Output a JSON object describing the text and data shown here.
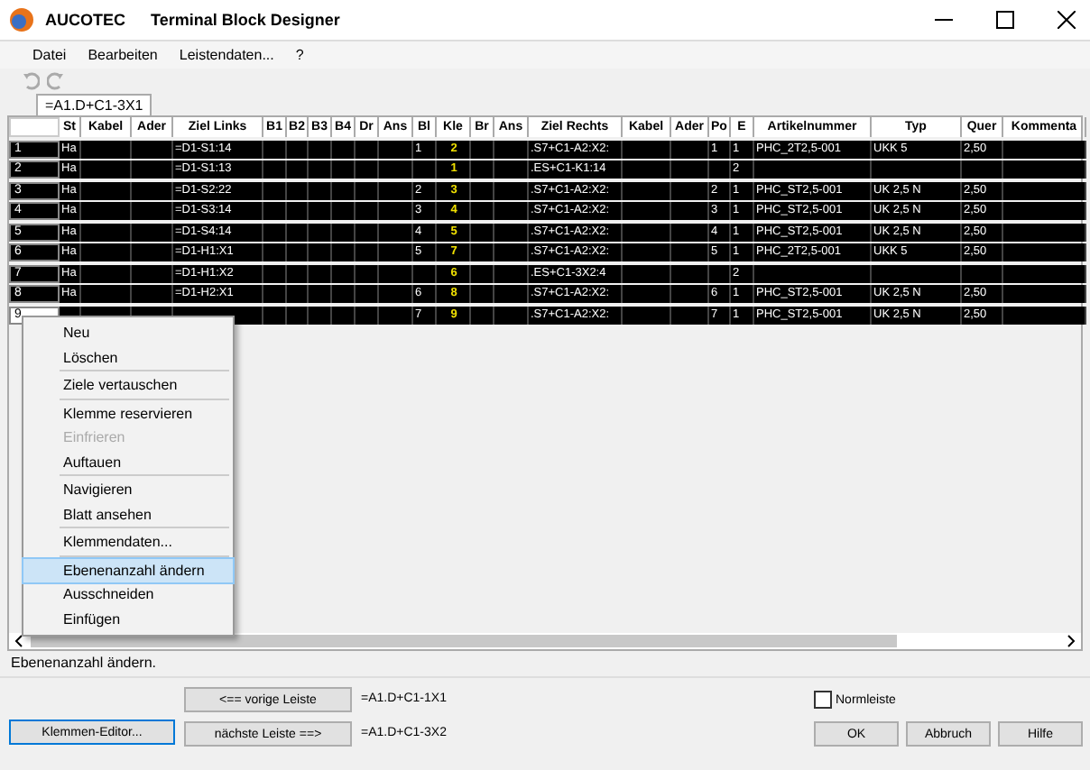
{
  "window": {
    "brand": "AUCOTEC",
    "title": "Terminal Block Designer"
  },
  "menu_bar": [
    "Datei",
    "Bearbeiten",
    "Leistendaten...",
    "?"
  ],
  "tab": {
    "label": "=A1.D+C1-3X1"
  },
  "table": {
    "columns": [
      {
        "label": "St",
        "kind": "text"
      },
      {
        "label": "Kabel",
        "kind": "text"
      },
      {
        "label": "Ader",
        "kind": "text"
      },
      {
        "label": "Ziel Links",
        "kind": "text"
      },
      {
        "label": "B1",
        "kind": "text"
      },
      {
        "label": "B2",
        "kind": "text"
      },
      {
        "label": "B3",
        "kind": "text"
      },
      {
        "label": "B4",
        "kind": "text"
      },
      {
        "label": "Dr",
        "kind": "text"
      },
      {
        "label": "Ans",
        "kind": "text"
      },
      {
        "label": "Bl",
        "kind": "text"
      },
      {
        "label": "Kle",
        "kind": "terminal"
      },
      {
        "label": "Br",
        "kind": "text"
      },
      {
        "label": "Ans",
        "kind": "text"
      },
      {
        "label": "Ziel Rechts",
        "kind": "text"
      },
      {
        "label": "Kabel",
        "kind": "text"
      },
      {
        "label": "Ader",
        "kind": "text"
      },
      {
        "label": "Po",
        "kind": "text"
      },
      {
        "label": "E",
        "kind": "text"
      },
      {
        "label": "Artikelnummer",
        "kind": "text"
      },
      {
        "label": "Typ",
        "kind": "text"
      },
      {
        "label": "Quer",
        "kind": "text"
      },
      {
        "label": "Kommenta",
        "kind": "text"
      }
    ],
    "rows": [
      {
        "number": "1",
        "selected": false,
        "cells": [
          "Ha",
          null,
          null,
          "=D1-S1:14",
          null,
          null,
          null,
          null,
          null,
          null,
          "1",
          "2",
          null,
          null,
          ".S7+C1-A2:X2:",
          null,
          null,
          "1",
          "1",
          "PHC_2T2,5-001",
          "UKK 5",
          "2,50",
          null
        ]
      },
      {
        "number": "2",
        "selected": false,
        "cells": [
          "Ha",
          null,
          null,
          "=D1-S1:13",
          null,
          null,
          null,
          null,
          null,
          null,
          null,
          "1",
          null,
          null,
          ".ES+C1-K1:14",
          null,
          null,
          null,
          "2",
          null,
          null,
          null,
          null
        ]
      },
      {
        "number": "3",
        "selected": false,
        "cells": [
          "Ha",
          null,
          null,
          "=D1-S2:22",
          null,
          null,
          null,
          null,
          null,
          null,
          "2",
          "3",
          null,
          null,
          ".S7+C1-A2:X2:",
          null,
          null,
          "2",
          "1",
          "PHC_ST2,5-001",
          "UK 2,5 N",
          "2,50",
          null
        ]
      },
      {
        "number": "4",
        "selected": false,
        "cells": [
          "Ha",
          null,
          null,
          "=D1-S3:14",
          null,
          null,
          null,
          null,
          null,
          null,
          "3",
          "4",
          null,
          null,
          ".S7+C1-A2:X2:",
          null,
          null,
          "3",
          "1",
          "PHC_ST2,5-001",
          "UK 2,5 N",
          "2,50",
          null
        ]
      },
      {
        "number": "5",
        "selected": false,
        "cells": [
          "Ha",
          null,
          null,
          "=D1-S4:14",
          null,
          null,
          null,
          null,
          null,
          null,
          "4",
          "5",
          null,
          null,
          ".S7+C1-A2:X2:",
          null,
          null,
          "4",
          "1",
          "PHC_ST2,5-001",
          "UK 2,5 N",
          "2,50",
          null
        ]
      },
      {
        "number": "6",
        "selected": false,
        "cells": [
          "Ha",
          null,
          null,
          "=D1-H1:X1",
          null,
          null,
          null,
          null,
          null,
          null,
          "5",
          "7",
          null,
          null,
          ".S7+C1-A2:X2:",
          null,
          null,
          "5",
          "1",
          "PHC_2T2,5-001",
          "UKK 5",
          "2,50",
          null
        ]
      },
      {
        "number": "7",
        "selected": false,
        "cells": [
          "Ha",
          null,
          null,
          "=D1-H1:X2",
          null,
          null,
          null,
          null,
          null,
          null,
          null,
          "6",
          null,
          null,
          ".ES+C1-3X2:4",
          null,
          null,
          null,
          "2",
          null,
          null,
          null,
          null
        ]
      },
      {
        "number": "8",
        "selected": false,
        "cells": [
          "Ha",
          null,
          null,
          "=D1-H2:X1",
          null,
          null,
          null,
          null,
          null,
          null,
          "6",
          "8",
          null,
          null,
          ".S7+C1-A2:X2:",
          null,
          null,
          "6",
          "1",
          "PHC_ST2,5-001",
          "UK 2,5 N",
          "2,50",
          null
        ]
      },
      {
        "number": "9",
        "selected": true,
        "cells": [
          null,
          null,
          null,
          null,
          null,
          null,
          null,
          null,
          null,
          null,
          "7",
          "9",
          null,
          null,
          ".S7+C1-A2:X2:",
          null,
          null,
          "7",
          "1",
          "PHC_ST2,5-001",
          "UK 2,5 N",
          "2,50",
          null
        ]
      }
    ]
  },
  "context_menu": [
    [
      {
        "label": "Neu",
        "disabled": false,
        "selected": false
      },
      {
        "label": "Löschen",
        "disabled": false,
        "selected": false
      }
    ],
    [
      {
        "label": "Ziele vertauschen",
        "disabled": false,
        "selected": false
      }
    ],
    [
      {
        "label": "Klemme reservieren",
        "disabled": false,
        "selected": false
      },
      {
        "label": "Einfrieren",
        "disabled": true,
        "selected": false
      },
      {
        "label": "Auftauen",
        "disabled": false,
        "selected": false
      }
    ],
    [
      {
        "label": "Navigieren",
        "disabled": false,
        "selected": false
      },
      {
        "label": "Blatt ansehen",
        "disabled": false,
        "selected": false
      }
    ],
    [
      {
        "label": "Klemmendaten...",
        "disabled": false,
        "selected": false
      }
    ],
    [
      {
        "label": "Ebenenanzahl ändern",
        "disabled": false,
        "selected": true
      },
      {
        "label": "Ausschneiden",
        "disabled": false,
        "selected": false
      },
      {
        "label": "Einfügen",
        "disabled": false,
        "selected": false
      }
    ]
  ],
  "status_bar": "Ebenenanzahl ändern.",
  "footer": {
    "editor_button": "Klemmen-Editor...",
    "prev_button": "<== vorige Leiste",
    "prev_label": "=A1.D+C1-1X1",
    "next_button": "nächste Leiste ==>",
    "next_label": "=A1.D+C1-3X2",
    "checkbox": {
      "label": "Normleiste",
      "checked": false
    },
    "buttons": [
      "OK",
      "Abbruch",
      "Hilfe"
    ]
  }
}
